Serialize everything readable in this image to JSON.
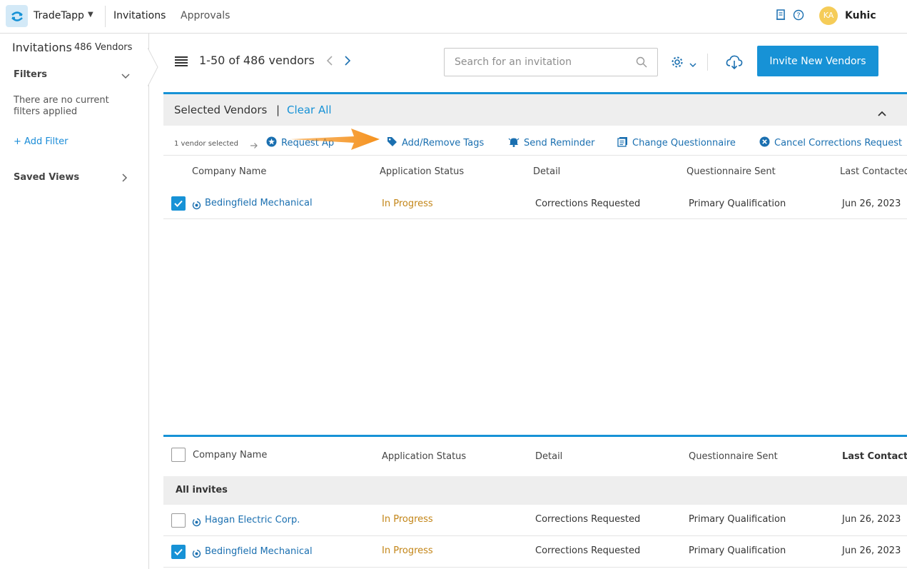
{
  "topbar": {
    "brand": "TradeTapp",
    "nav": [
      "Invitations",
      "Approvals"
    ],
    "avatar_initials": "KA",
    "user_name": "Kuhic",
    "icons": [
      "document-icon",
      "help-icon"
    ]
  },
  "sidebar": {
    "title": "Invitations",
    "count": "486 Vendors",
    "filters_label": "Filters",
    "empty_text": "There are no current filters applied",
    "add_filter": "+ Add Filter",
    "saved_views": "Saved Views"
  },
  "toolbar": {
    "pager": "1-50 of 486 vendors",
    "search_placeholder": "Search for an invitation",
    "invite_button": "Invite New Vendors"
  },
  "selected": {
    "title": "Selected Vendors",
    "separator": "|",
    "clear_all": "Clear All",
    "count_text": "1 vendor selected",
    "actions": {
      "request_approval": "Request Ap",
      "tags": "Add/Remove Tags",
      "reminder": "Send Reminder",
      "questionnaire": "Change Questionnaire",
      "cancel": "Cancel Corrections Request"
    },
    "columns": [
      "Company Name",
      "Application Status",
      "Detail",
      "Questionnaire Sent",
      "Last Contacted"
    ],
    "rows": [
      {
        "company": "Bedingfield Mechanical",
        "status": "In Progress",
        "detail": "Corrections Requested",
        "questionnaire": "Primary Qualification",
        "last": "Jun 26, 2023",
        "checked": true
      }
    ]
  },
  "all": {
    "columns": [
      "Company Name",
      "Application Status",
      "Detail",
      "Questionnaire Sent",
      "Last Contacte"
    ],
    "group_label": "All invites",
    "rows": [
      {
        "company": "Hagan Electric Corp.",
        "status": "In Progress",
        "detail": "Corrections Requested",
        "questionnaire": "Primary Qualification",
        "last": "Jun 26, 2023",
        "checked": false
      },
      {
        "company": "Bedingfield Mechanical",
        "status": "In Progress",
        "detail": "Corrections Requested",
        "questionnaire": "Primary Qualification",
        "last": "Jun 26, 2023",
        "checked": true
      }
    ]
  },
  "colors": {
    "accent": "#1792d6",
    "link": "#1a6fb0",
    "status_in_progress": "#c38517",
    "callout": "#f5921e"
  }
}
